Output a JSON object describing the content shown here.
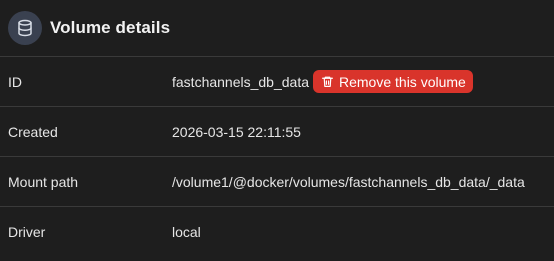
{
  "header": {
    "title": "Volume details",
    "icon": "database-icon"
  },
  "rows": [
    {
      "label": "ID",
      "value": "fastchannels_db_data"
    },
    {
      "label": "Created",
      "value": "2026-03-15 22:11:55"
    },
    {
      "label": "Mount path",
      "value": "/volume1/@docker/volumes/fastchannels_db_data/_data"
    },
    {
      "label": "Driver",
      "value": "local"
    }
  ],
  "actions": {
    "remove_label": "Remove this volume",
    "remove_icon": "trash-icon"
  },
  "colors": {
    "background": "#1e1e1e",
    "danger": "#d9342b",
    "icon_circle": "#3a4150"
  }
}
